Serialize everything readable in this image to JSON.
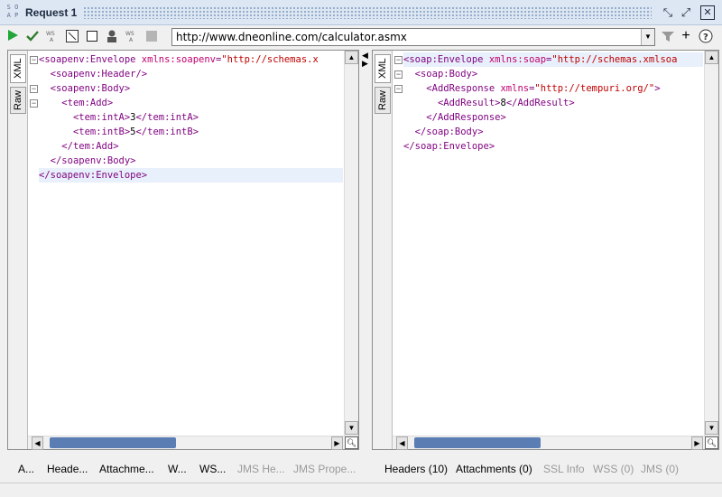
{
  "window": {
    "logo": [
      "S O",
      "A P"
    ],
    "title": "Request 1",
    "buttons": {
      "restore": "⤡",
      "maximize": "⤢",
      "close": "✕"
    }
  },
  "toolbar": {
    "icons": [
      "play-icon",
      "check-icon",
      "wsa-icon",
      "format-icon",
      "stop-icon",
      "user-icon",
      "wsa2-icon",
      "square-icon"
    ],
    "url": "http://www.dneonline.com/calculator.asmx",
    "right_icons": [
      "filter-icon",
      "add-icon",
      "help-icon"
    ]
  },
  "request": {
    "tabs": {
      "xml": "XML",
      "raw": "Raw"
    },
    "lines": [
      {
        "indent": 0,
        "parts": [
          [
            "tag",
            "<soapenv:Envelope "
          ],
          [
            "aname",
            "xmlns:soapenv"
          ],
          [
            "tag",
            "="
          ],
          [
            "val",
            "\"http://schemas.x"
          ]
        ]
      },
      {
        "indent": 2,
        "parts": [
          [
            "tag",
            "<soapenv:Header/>"
          ]
        ]
      },
      {
        "indent": 2,
        "parts": [
          [
            "tag",
            "<soapenv:Body>"
          ]
        ]
      },
      {
        "indent": 4,
        "parts": [
          [
            "tag",
            "<tem:Add>"
          ]
        ]
      },
      {
        "indent": 6,
        "parts": [
          [
            "tag",
            "<tem:intA>"
          ],
          [
            "txt",
            "3"
          ],
          [
            "tag",
            "</tem:intA>"
          ]
        ]
      },
      {
        "indent": 6,
        "parts": [
          [
            "tag",
            "<tem:intB>"
          ],
          [
            "txt",
            "5"
          ],
          [
            "tag",
            "</tem:intB>"
          ]
        ]
      },
      {
        "indent": 4,
        "parts": [
          [
            "tag",
            "</tem:Add>"
          ]
        ]
      },
      {
        "indent": 2,
        "parts": [
          [
            "tag",
            "</soapenv:Body>"
          ]
        ]
      },
      {
        "indent": 0,
        "parts": [
          [
            "tag",
            "</soapenv:Envelope>"
          ]
        ]
      }
    ]
  },
  "response": {
    "tabs": {
      "xml": "XML",
      "raw": "Raw"
    },
    "lines": [
      {
        "indent": 0,
        "parts": [
          [
            "tag",
            "<soap:Envelope "
          ],
          [
            "aname",
            "xmlns:soap"
          ],
          [
            "tag",
            "="
          ],
          [
            "val",
            "\"http://schemas.xmlsoa"
          ]
        ]
      },
      {
        "indent": 2,
        "parts": [
          [
            "tag",
            "<soap:Body>"
          ]
        ]
      },
      {
        "indent": 4,
        "parts": [
          [
            "tag",
            "<AddResponse "
          ],
          [
            "aname",
            "xmlns"
          ],
          [
            "tag",
            "="
          ],
          [
            "val",
            "\"http://tempuri.org/\""
          ],
          [
            "tag",
            ">"
          ]
        ]
      },
      {
        "indent": 6,
        "parts": [
          [
            "tag",
            "<AddResult>"
          ],
          [
            "txt",
            "8"
          ],
          [
            "tag",
            "</AddResult>"
          ]
        ]
      },
      {
        "indent": 4,
        "parts": [
          [
            "tag",
            "</AddResponse>"
          ]
        ]
      },
      {
        "indent": 2,
        "parts": [
          [
            "tag",
            "</soap:Body>"
          ]
        ]
      },
      {
        "indent": 0,
        "parts": [
          [
            "tag",
            "</soap:Envelope>"
          ]
        ]
      }
    ]
  },
  "bottom": {
    "left_tabs": [
      {
        "label": "A...",
        "enabled": true
      },
      {
        "label": "Heade...",
        "enabled": true
      },
      {
        "label": "Attachme...",
        "enabled": true
      },
      {
        "label": "W...",
        "enabled": true
      },
      {
        "label": "WS...",
        "enabled": true
      },
      {
        "label": "JMS He...",
        "enabled": false
      },
      {
        "label": "JMS Prope...",
        "enabled": false
      }
    ],
    "right_tabs": [
      {
        "label": "Headers (10)",
        "enabled": true
      },
      {
        "label": "Attachments (0)",
        "enabled": true
      },
      {
        "label": "SSL Info",
        "enabled": false
      },
      {
        "label": "WSS (0)",
        "enabled": false
      },
      {
        "label": "JMS (0)",
        "enabled": false
      }
    ]
  }
}
